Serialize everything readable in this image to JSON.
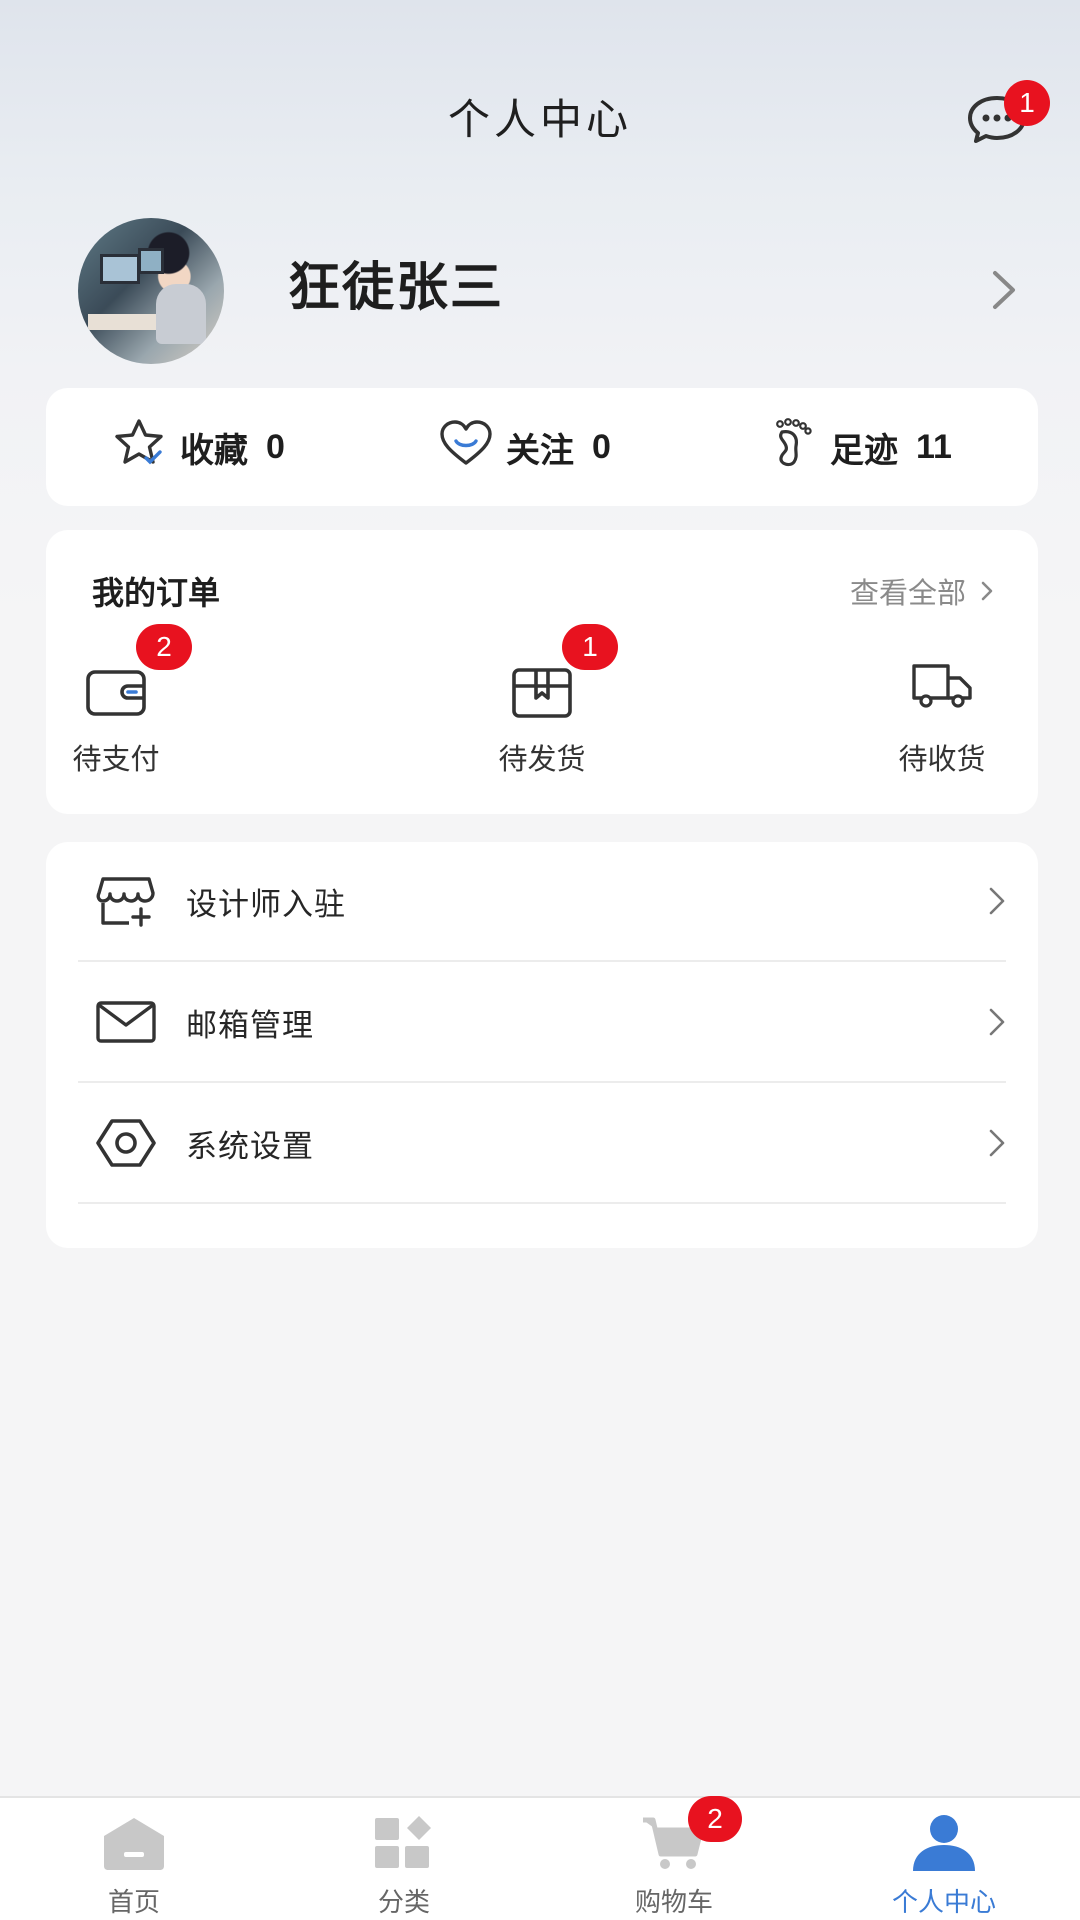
{
  "header": {
    "title": "个人中心",
    "message_badge": "1"
  },
  "profile": {
    "username": "狂徒张三"
  },
  "stats": [
    {
      "label": "收藏",
      "value": "0",
      "icon": "star-icon"
    },
    {
      "label": "关注",
      "value": "0",
      "icon": "heart-icon"
    },
    {
      "label": "足迹",
      "value": "11",
      "icon": "footprint-icon"
    }
  ],
  "orders": {
    "title": "我的订单",
    "view_all": "查看全部",
    "items": [
      {
        "label": "待支付",
        "badge": "2",
        "icon": "wallet-icon"
      },
      {
        "label": "待发货",
        "badge": "1",
        "icon": "box-icon"
      },
      {
        "label": "待收货",
        "badge": "",
        "icon": "truck-icon"
      }
    ]
  },
  "menu": [
    {
      "label": "设计师入驻",
      "icon": "store-add-icon"
    },
    {
      "label": "邮箱管理",
      "icon": "mail-icon"
    },
    {
      "label": "系统设置",
      "icon": "settings-icon"
    }
  ],
  "tabbar": {
    "items": [
      {
        "label": "首页",
        "icon": "home-icon"
      },
      {
        "label": "分类",
        "icon": "category-icon"
      },
      {
        "label": "购物车",
        "icon": "cart-icon",
        "badge": "2"
      },
      {
        "label": "个人中心",
        "icon": "user-icon",
        "active": true
      }
    ]
  },
  "colors": {
    "accent": "#3a7bd5",
    "badge": "#e8121f",
    "inactive_tab": "#c8c8c8"
  }
}
